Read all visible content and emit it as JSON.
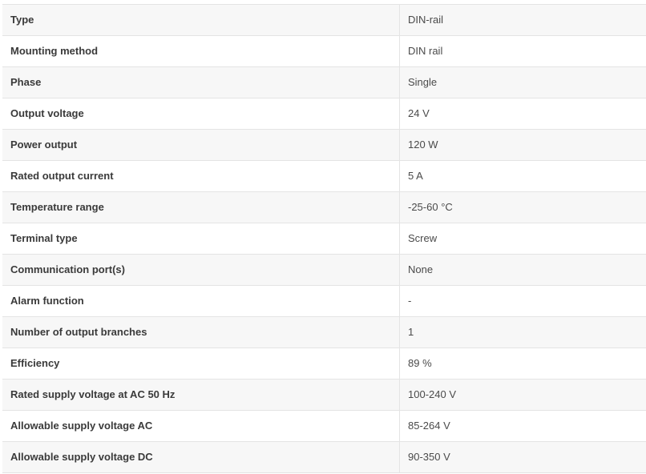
{
  "specs": [
    {
      "label": "Type",
      "value": "DIN-rail"
    },
    {
      "label": "Mounting method",
      "value": "DIN rail"
    },
    {
      "label": "Phase",
      "value": "Single"
    },
    {
      "label": "Output voltage",
      "value": "24 V"
    },
    {
      "label": "Power output",
      "value": "120 W"
    },
    {
      "label": "Rated output current",
      "value": "5 A"
    },
    {
      "label": "Temperature range",
      "value": "-25-60 °C"
    },
    {
      "label": "Terminal type",
      "value": "Screw"
    },
    {
      "label": "Communication port(s)",
      "value": "None"
    },
    {
      "label": "Alarm function",
      "value": "-"
    },
    {
      "label": "Number of output branches",
      "value": "1"
    },
    {
      "label": "Efficiency",
      "value": "89 %"
    },
    {
      "label": "Rated supply voltage at AC 50 Hz",
      "value": "100-240 V"
    },
    {
      "label": "Allowable supply voltage AC",
      "value": "85-264 V"
    },
    {
      "label": "Allowable supply voltage DC",
      "value": "90-350 V"
    }
  ],
  "colors": {
    "row_shaded": "#f7f7f7",
    "row_plain": "#ffffff",
    "border": "#e4e4e4",
    "text": "#333333"
  }
}
